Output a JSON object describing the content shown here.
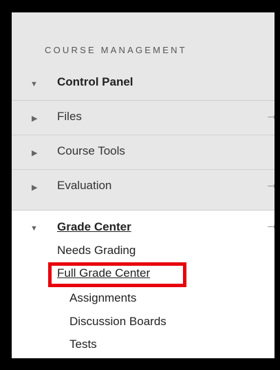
{
  "section": {
    "title": "COURSE MANAGEMENT"
  },
  "control_panel": {
    "label": "Control Panel"
  },
  "items": [
    {
      "label": "Files",
      "has_arrow": true
    },
    {
      "label": "Course Tools",
      "has_arrow": false
    },
    {
      "label": "Evaluation",
      "has_arrow": true
    }
  ],
  "grade_center": {
    "label": "Grade Center",
    "arrow": "→",
    "links": {
      "needs_grading": "Needs Grading",
      "full_grade_center": "Full Grade Center",
      "assignments": "Assignments",
      "discussion_boards": "Discussion Boards",
      "tests": "Tests"
    }
  },
  "icons": {
    "collapse": "▼",
    "expand": "▶",
    "arrow": "→"
  },
  "colors": {
    "highlight": "#e8000b",
    "panel_bg": "#e7e7e7"
  }
}
